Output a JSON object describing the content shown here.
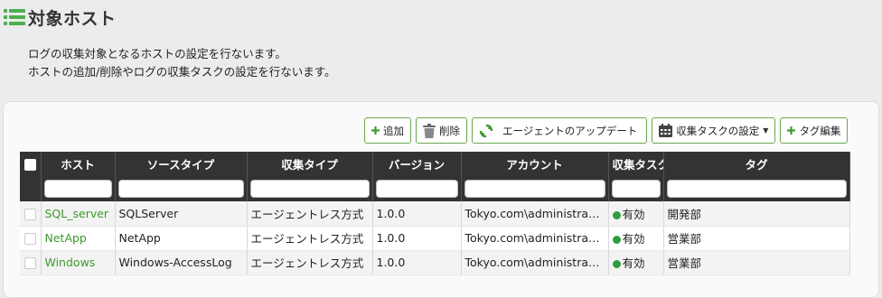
{
  "page": {
    "title": "対象ホスト",
    "description": [
      "ログの収集対象となるホストの設定を行ないます。",
      "ホストの追加/削除やログの収集タスクの設定を行ないます。"
    ]
  },
  "toolbar": {
    "add_label": "追加",
    "delete_label": "削除",
    "update_agent_label": "エージェントのアップデート",
    "task_settings_label": "収集タスクの設定",
    "tag_edit_label": "タグ編集"
  },
  "table": {
    "columns": [
      "ホスト",
      "ソースタイプ",
      "収集タイプ",
      "バージョン",
      "アカウント",
      "収集タスク",
      "タグ"
    ],
    "rows": [
      {
        "host": "SQL_server",
        "source_type": "SQLServer",
        "collect_type": "エージェントレス方式",
        "version": "1.0.0",
        "account": "Tokyo.com\\administra…",
        "task": "有効",
        "tag": "開発部"
      },
      {
        "host": "NetApp",
        "source_type": "NetApp",
        "collect_type": "エージェントレス方式",
        "version": "1.0.0",
        "account": "Tokyo.com\\administra…",
        "task": "有効",
        "tag": "営業部"
      },
      {
        "host": "Windows",
        "source_type": "Windows-AccessLog",
        "collect_type": "エージェントレス方式",
        "version": "1.0.0",
        "account": "Tokyo.com\\administra…",
        "task": "有効",
        "tag": "営業部"
      }
    ]
  },
  "colors": {
    "accent": "#3d9a2e",
    "header_bg": "#333333",
    "status_enabled": "#2e9e3f"
  }
}
